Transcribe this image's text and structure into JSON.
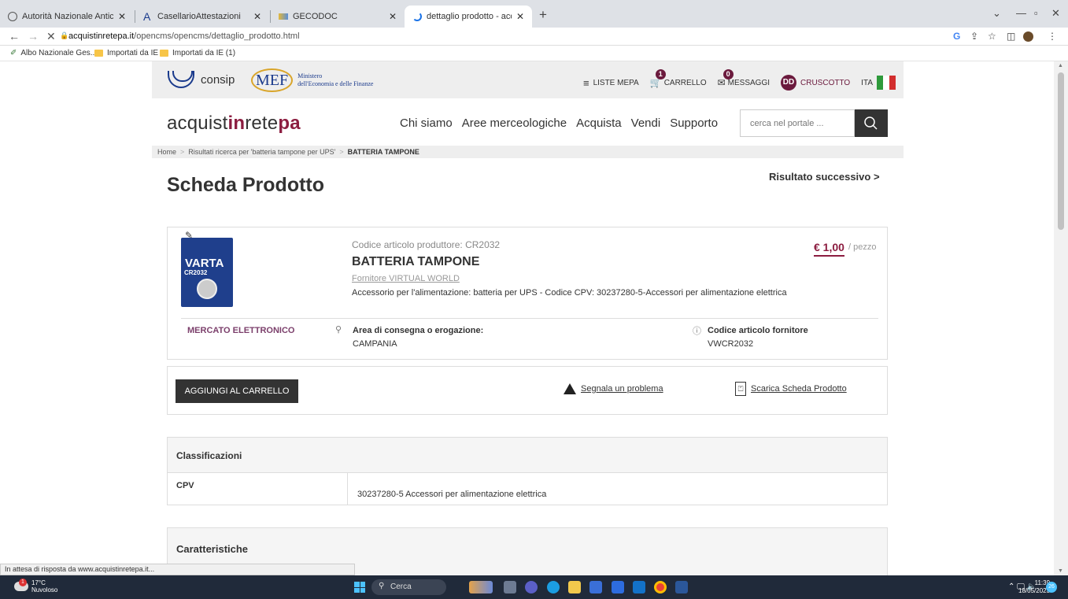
{
  "browser": {
    "tabs": [
      {
        "label": "Autorità Nazionale Anticorruzion",
        "icon": "globe-icon"
      },
      {
        "label": "CasellarioAttestazioni",
        "icon": "a-logo-icon"
      },
      {
        "label": "GECODOC",
        "icon": "gecodoc-icon"
      },
      {
        "label": "dettaglio prodotto - acquistinret",
        "icon": "loading-icon"
      }
    ],
    "url_domain": "acquistinretepa.it",
    "url_path": "/opencms/opencms/dettaglio_prodotto.html",
    "bookmarks": [
      "Albo Nazionale Ges...",
      "Importati da IE",
      "Importati da IE (1)"
    ],
    "status_text": "In attesa di risposta da www.acquistinretepa.it..."
  },
  "topbar": {
    "consip": "consip",
    "mef": "MEF",
    "mef_line1": "Ministero",
    "mef_line2": "dell'Economia e delle Finanze",
    "liste_mepa": "LISTE MEPA",
    "carrello": "CARRELLO",
    "carrello_count": "1",
    "messaggi": "MESSAGGI",
    "messaggi_count": "0",
    "user_initials": "DD",
    "cruscotto": "CRUSCOTTO",
    "lang": "ITA"
  },
  "brand": {
    "part1": "acquist",
    "part2": "in",
    "part3": "rete",
    "part4": "pa"
  },
  "nav": [
    "Chi siamo",
    "Aree merceologiche",
    "Acquista",
    "Vendi",
    "Supporto"
  ],
  "search": {
    "placeholder": "cerca nel portale ..."
  },
  "breadcrumb": {
    "home": "Home",
    "results": "Risultati ricerca per 'batteria tampone per UPS'",
    "current": "BATTERIA TAMPONE"
  },
  "page_title": "Scheda Prodotto",
  "next_result": "Risultato successivo  >",
  "product": {
    "img_brand": "VARTA",
    "img_model": "CR2032",
    "codice_produttore": "Codice articolo produttore: CR2032",
    "name": "BATTERIA TAMPONE",
    "fornitore": "Fornitore VIRTUAL WORLD",
    "description": "Accessorio per l'alimentazione: batteria per UPS - Codice CPV: 30237280-5-Accessori per alimentazione elettrica",
    "price": "€ 1,00",
    "price_unit": "/ pezzo",
    "mercato": "MERCATO ELETTRONICO",
    "area_label": "Area di consegna o erogazione:",
    "area_value": "CAMPANIA",
    "cod_forn_label": "Codice articolo fornitore",
    "cod_forn_value": "VWCR2032"
  },
  "actions": {
    "add_to_cart": "AGGIUNGI AL CARRELLO",
    "report": "Segnala un problema",
    "download": "Scarica Scheda Prodotto"
  },
  "classificazioni": {
    "header": "Classificazioni",
    "key": "CPV",
    "value": "30237280-5 Accessori per alimentazione elettrica"
  },
  "caratteristiche": {
    "header": "Caratteristiche"
  },
  "taskbar": {
    "temp": "17°C",
    "weather": "Nuvoloso",
    "weather_badge": "1",
    "search": "Cerca",
    "time": "11:39",
    "date": "18/05/2023",
    "notif": "26"
  },
  "colors": {
    "brand": "#8c1d40",
    "dark": "#333333"
  }
}
